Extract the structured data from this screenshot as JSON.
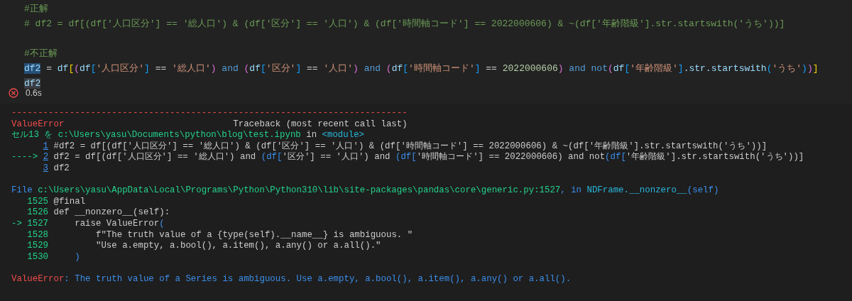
{
  "cell": {
    "blocks": [
      [
        {
          "tokens": [
            {
              "kind": "comment",
              "text": "#正解"
            }
          ]
        },
        {
          "tokens": [
            {
              "kind": "comment",
              "text": "# df2 = df[(df['人口区分'] == '総人口') & (df['区分'] == '人口') & (df['時間軸コード'] == 2022000606) & ~(df['年齢階級'].str.startswith('うち'))]"
            }
          ]
        }
      ],
      [
        {
          "tokens": [
            {
              "kind": "comment",
              "text": "#不正解"
            }
          ]
        },
        {
          "tokens": [
            {
              "kind": "selected",
              "text": "df2"
            },
            {
              "kind": "op",
              "text": " = "
            },
            {
              "kind": "var",
              "text": "df"
            },
            {
              "kind": "br1",
              "text": "["
            },
            {
              "kind": "br2",
              "text": "("
            },
            {
              "kind": "var",
              "text": "df"
            },
            {
              "kind": "br3",
              "text": "["
            },
            {
              "kind": "str",
              "text": "'人口区分'"
            },
            {
              "kind": "br3",
              "text": "]"
            },
            {
              "kind": "op",
              "text": " == "
            },
            {
              "kind": "str",
              "text": "'総人口'"
            },
            {
              "kind": "br2",
              "text": ")"
            },
            {
              "kind": "kw",
              "text": " and "
            },
            {
              "kind": "br2",
              "text": "("
            },
            {
              "kind": "var",
              "text": "df"
            },
            {
              "kind": "br3",
              "text": "["
            },
            {
              "kind": "str",
              "text": "'区分'"
            },
            {
              "kind": "br3",
              "text": "]"
            },
            {
              "kind": "op",
              "text": " == "
            },
            {
              "kind": "str",
              "text": "'人口'"
            },
            {
              "kind": "br2",
              "text": ")"
            },
            {
              "kind": "kw",
              "text": " and "
            },
            {
              "kind": "br2",
              "text": "("
            },
            {
              "kind": "var",
              "text": "df"
            },
            {
              "kind": "br3",
              "text": "["
            },
            {
              "kind": "str",
              "text": "'時間軸コード'"
            },
            {
              "kind": "br3",
              "text": "]"
            },
            {
              "kind": "op",
              "text": " == "
            },
            {
              "kind": "num",
              "text": "2022000606"
            },
            {
              "kind": "br2",
              "text": ")"
            },
            {
              "kind": "kw",
              "text": " and not"
            },
            {
              "kind": "br2",
              "text": "("
            },
            {
              "kind": "var",
              "text": "df"
            },
            {
              "kind": "br3",
              "text": "["
            },
            {
              "kind": "str",
              "text": "'年齢階級'"
            },
            {
              "kind": "br3",
              "text": "]"
            },
            {
              "kind": "var",
              "text": ".str.startswith"
            },
            {
              "kind": "br3",
              "text": "("
            },
            {
              "kind": "str",
              "text": "'うち'"
            },
            {
              "kind": "br3",
              "text": ")"
            },
            {
              "kind": "br2",
              "text": ")"
            },
            {
              "kind": "br1",
              "text": "]"
            }
          ]
        },
        {
          "tokens": [
            {
              "kind": "occurrence",
              "text": "df2"
            }
          ]
        }
      ]
    ],
    "status": {
      "failed": true,
      "time": "0.6s"
    }
  },
  "output": {
    "sections": [
      [
        {
          "tokens": [
            {
              "kind": "error",
              "text": "---------------------------------------------------------------------------"
            }
          ]
        },
        {
          "tokens": [
            {
              "kind": "error",
              "text": "ValueError"
            },
            {
              "kind": "plain",
              "text": "                                Traceback (most recent call last)"
            }
          ]
        },
        {
          "tokens": [
            {
              "kind": "path",
              "text": "セル13 を c:\\Users\\yasu\\Documents\\python\\blog\\test.ipynb"
            },
            {
              "kind": "plain",
              "text": " in "
            },
            {
              "kind": "name",
              "text": "<module>"
            }
          ]
        },
        {
          "tokens": [
            {
              "kind": "lineno",
              "text": "1"
            },
            {
              "kind": "plain",
              "text": " #df2 = df[(df['人口区分'] == '総人口') & (df['区分'] == '人口') & (df['時間軸コード'] == 2022000606) & ~(df['年齢階級'].str.startswith('うち'))]"
            }
          ]
        },
        {
          "tokens": [
            {
              "kind": "path",
              "text": "----> "
            },
            {
              "kind": "lineno",
              "text": "2"
            },
            {
              "kind": "plain",
              "text": " df2 = df[(df['人口区分'] == '総人口') and "
            },
            {
              "kind": "keyword",
              "text": "(df["
            },
            {
              "kind": "plain",
              "text": "'区分'] == '人口') and "
            },
            {
              "kind": "keyword",
              "text": "(df["
            },
            {
              "kind": "plain",
              "text": "'時間軸コード'] == 2022000606) and not"
            },
            {
              "kind": "keyword",
              "text": "(df["
            },
            {
              "kind": "plain",
              "text": "'年齢階級'].str.startswith('うち'))]"
            }
          ]
        },
        {
          "tokens": [
            {
              "kind": "lineno",
              "text": "3"
            },
            {
              "kind": "plain",
              "text": " df2"
            }
          ]
        }
      ],
      [
        {
          "tokens": [
            {
              "kind": "keyword",
              "text": "File"
            },
            {
              "kind": "path",
              "text": " c:\\Users\\yasu\\AppData\\Local\\Programs\\Python\\Python310\\lib\\site-packages\\pandas\\core\\generic.py:1527"
            },
            {
              "kind": "keyword",
              "text": ", in "
            },
            {
              "kind": "name",
              "text": "NDFrame.__nonzero__"
            },
            {
              "kind": "keyword",
              "text": "(self)"
            }
          ]
        },
        {
          "tokens": [
            {
              "kind": "path",
              "text": "   1525"
            },
            {
              "kind": "plain",
              "text": " @final"
            }
          ]
        },
        {
          "tokens": [
            {
              "kind": "path",
              "text": "   1526"
            },
            {
              "kind": "plain",
              "text": " def __nonzero__(self):"
            }
          ]
        },
        {
          "tokens": [
            {
              "kind": "path",
              "text": "-> 1527"
            },
            {
              "kind": "plain",
              "text": "     raise ValueError"
            },
            {
              "kind": "keyword",
              "text": "("
            }
          ]
        },
        {
          "tokens": [
            {
              "kind": "path",
              "text": "   1528"
            },
            {
              "kind": "plain",
              "text": "         f\"The truth value of a {type(self).__name__} is ambiguous. \""
            }
          ]
        },
        {
          "tokens": [
            {
              "kind": "path",
              "text": "   1529"
            },
            {
              "kind": "plain",
              "text": "         \"Use a.empty, a.bool(), a.item(), a.any() or a.all().\""
            }
          ]
        },
        {
          "tokens": [
            {
              "kind": "path",
              "text": "   1530"
            },
            {
              "kind": "keyword",
              "text": "     )"
            }
          ]
        }
      ],
      [
        {
          "tokens": [
            {
              "kind": "error",
              "text": "ValueError"
            },
            {
              "kind": "keyword",
              "text": ": The truth value of a Series is ambiguous. Use a.empty, a.bool(), a.item(), a.any() or a.all()."
            }
          ]
        }
      ]
    ]
  }
}
